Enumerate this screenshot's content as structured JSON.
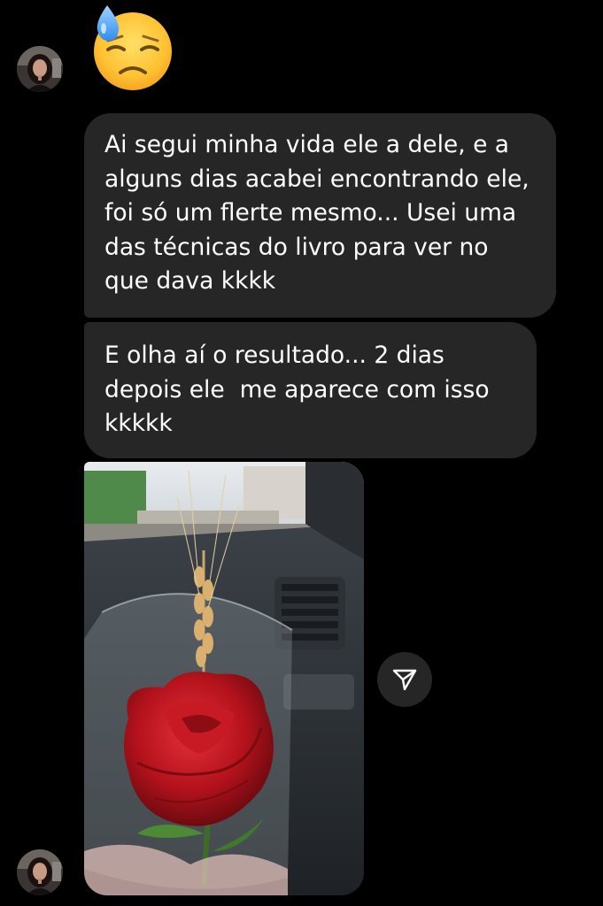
{
  "messages": [
    {
      "type": "emoji",
      "icon": "downcast-face-with-sweat-icon"
    },
    {
      "type": "text",
      "text": "Ai segui minha vida ele a dele, e a alguns dias acabei encontrando ele, foi só um flerte mesmo... Usei uma das técnicas do livro para ver no que dava kkkk"
    },
    {
      "type": "text",
      "text": "E olha aí o resultado... 2 dias depois ele  me aparece com isso kkkkk"
    },
    {
      "type": "image",
      "subject": "red-rose-photo"
    }
  ],
  "actions": {
    "share_icon": "paper-plane-icon"
  },
  "colors": {
    "background": "#000000",
    "bubble": "#262626",
    "text": "#ffffff"
  }
}
